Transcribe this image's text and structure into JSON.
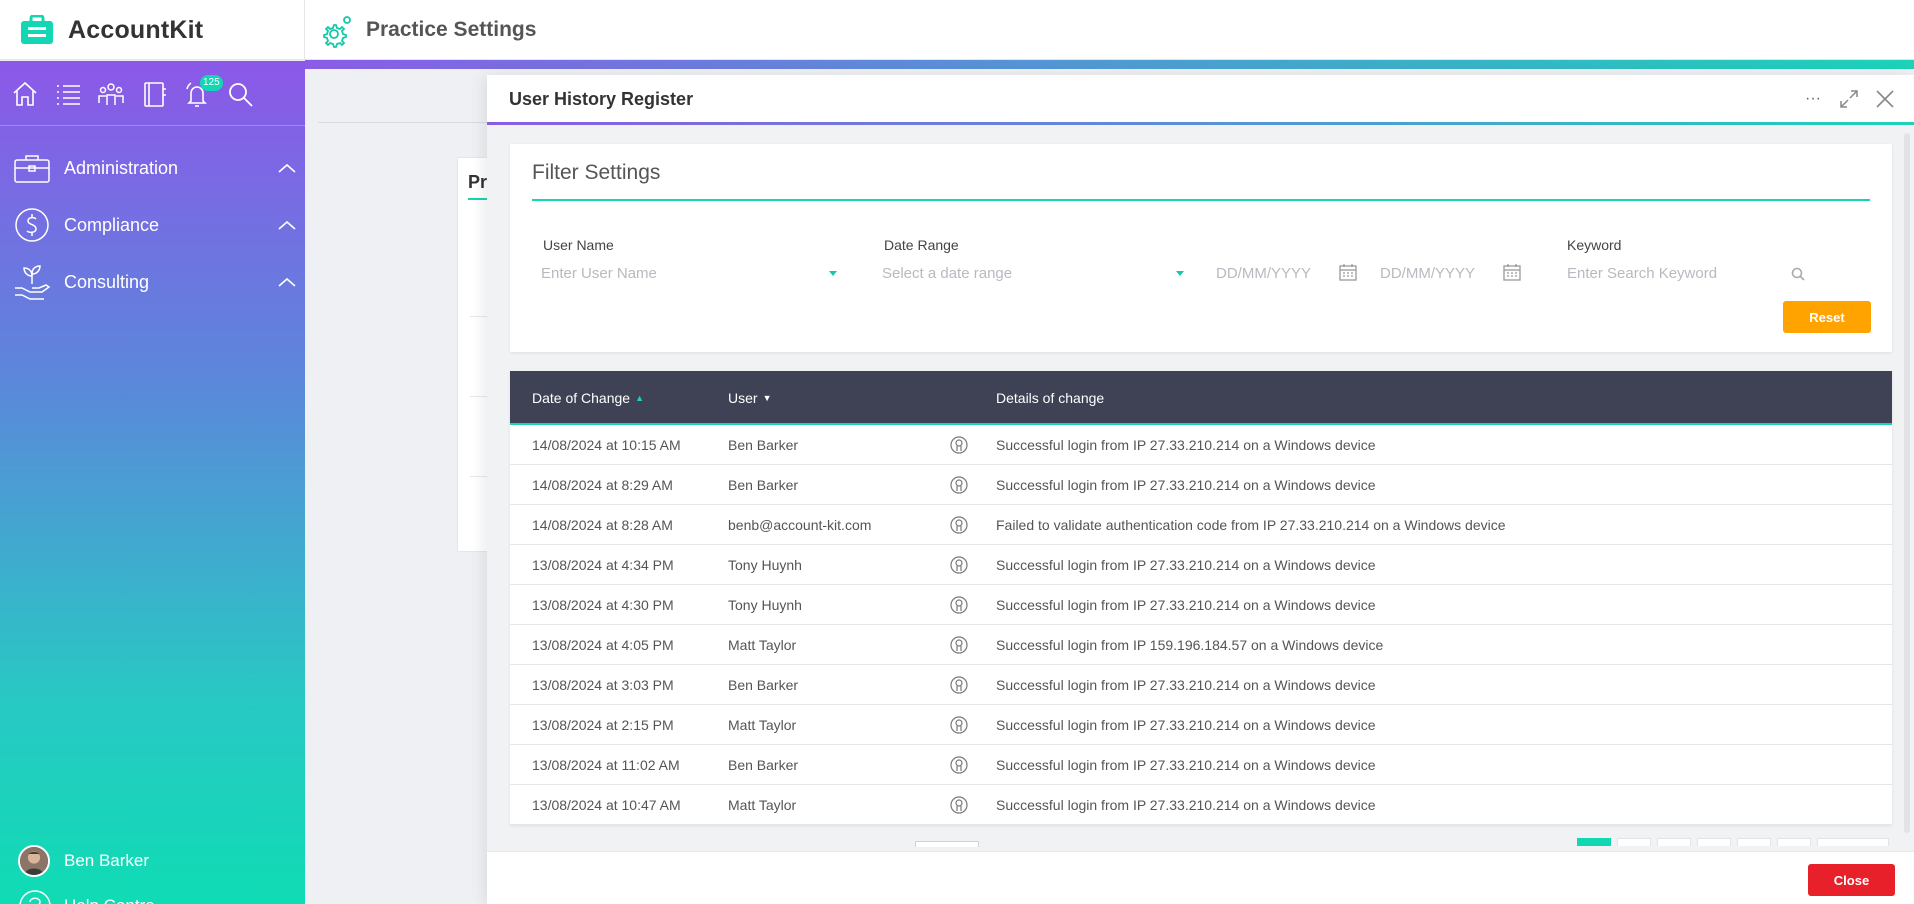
{
  "app": {
    "name": "AccountKit",
    "page_title": "Practice Settings"
  },
  "sidebar": {
    "notification_count": "125",
    "items": [
      {
        "label": "Administration"
      },
      {
        "label": "Compliance"
      },
      {
        "label": "Consulting"
      }
    ],
    "user_name": "Ben Barker",
    "help_label": "Help Centre"
  },
  "background": {
    "card_title": "Pr"
  },
  "modal": {
    "title": "User History Register",
    "more_label": "···",
    "filter": {
      "title": "Filter Settings",
      "user_name_label": "User Name",
      "user_name_placeholder": "Enter User Name",
      "date_range_label": "Date Range",
      "date_range_placeholder": "Select a date range",
      "date_from_placeholder": "DD/MM/YYYY",
      "date_to_placeholder": "DD/MM/YYYY",
      "keyword_label": "Keyword",
      "keyword_placeholder": "Enter Search Keyword",
      "reset_label": "Reset"
    },
    "table": {
      "headers": {
        "date": "Date of Change",
        "user": "User",
        "details": "Details of change"
      },
      "rows": [
        {
          "date": "14/08/2024 at 10:15 AM",
          "user": "Ben Barker",
          "details": "Successful login from IP 27.33.210.214 on a Windows device"
        },
        {
          "date": "14/08/2024 at 8:29 AM",
          "user": "Ben Barker",
          "details": "Successful login from IP 27.33.210.214 on a Windows device"
        },
        {
          "date": "14/08/2024 at 8:28 AM",
          "user": "benb@account-kit.com",
          "details": "Failed to validate authentication code from IP 27.33.210.214 on a Windows device"
        },
        {
          "date": "13/08/2024 at 4:34 PM",
          "user": "Tony Huynh",
          "details": "Successful login from IP 27.33.210.214 on a Windows device"
        },
        {
          "date": "13/08/2024 at 4:30 PM",
          "user": "Tony Huynh",
          "details": "Successful login from IP 27.33.210.214 on a Windows device"
        },
        {
          "date": "13/08/2024 at 4:05 PM",
          "user": "Matt Taylor",
          "details": "Successful login from IP 159.196.184.57 on a Windows device"
        },
        {
          "date": "13/08/2024 at 3:03 PM",
          "user": "Ben Barker",
          "details": "Successful login from IP 27.33.210.214 on a Windows device"
        },
        {
          "date": "13/08/2024 at 2:15 PM",
          "user": "Matt Taylor",
          "details": "Successful login from IP 27.33.210.214 on a Windows device"
        },
        {
          "date": "13/08/2024 at 11:02 AM",
          "user": "Ben Barker",
          "details": "Successful login from IP 27.33.210.214 on a Windows device"
        },
        {
          "date": "13/08/2024 at 10:47 AM",
          "user": "Matt Taylor",
          "details": "Successful login from IP 27.33.210.214 on a Windows device"
        }
      ]
    },
    "close_label": "Close"
  },
  "colors": {
    "accent": "#13d6b3",
    "reset": "#ffa300",
    "close": "#e8202a",
    "table_header": "#3f4254"
  }
}
